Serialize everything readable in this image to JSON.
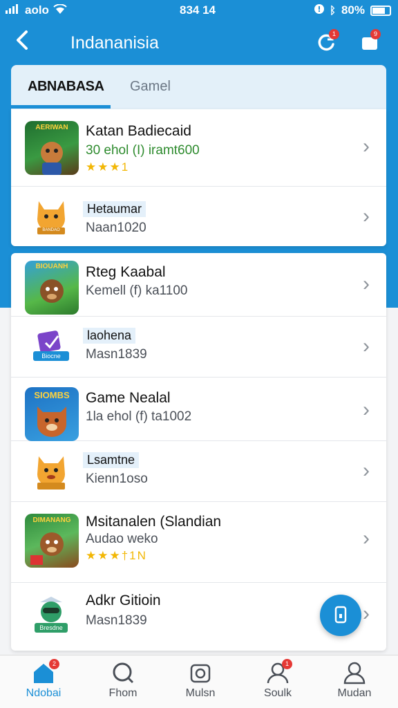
{
  "status": {
    "carrier": "aolo",
    "time": "834 14",
    "battery": "80%"
  },
  "header": {
    "title": "Indananisia",
    "refresh_badge": "1",
    "notify_badge": "9"
  },
  "tabs": [
    {
      "label": "ABNABASA"
    },
    {
      "label": "Gamel"
    }
  ],
  "card1": [
    {
      "title": "Katan Badiecaid",
      "sub": "30 ehol (I) iramt600",
      "stars": "★★★1",
      "thumb": "AERIWAN"
    },
    {
      "title": "Hetaumar",
      "sub": "Naan1020",
      "thumb": "BANDAO"
    }
  ],
  "card2": [
    {
      "title": "Rteg Kaabal",
      "sub": "Kemell (f) ka1100",
      "thumb": "BIOUANH"
    },
    {
      "title": "laohena",
      "sub": "Masn1839",
      "thumb": "Biocne"
    },
    {
      "title": "Game Nealal",
      "sub": "1la ehol (f) ta1002",
      "thumb": "SIOMBS"
    },
    {
      "title": "Lsamtne",
      "sub": "Kienn1oso",
      "thumb": ""
    },
    {
      "title": "Msitanalen (Slandian",
      "sub": "Audao weko",
      "stars": "★★★†1N",
      "thumb": "DIMANANG"
    },
    {
      "title": "Adkr Gitioin",
      "sub": "Masn1839",
      "thumb": "Bresdne"
    }
  ],
  "nav": [
    {
      "label": "Ndobai",
      "badge": "2"
    },
    {
      "label": "Fhom"
    },
    {
      "label": "Mulsn"
    },
    {
      "label": "Soulk",
      "badge": "1"
    },
    {
      "label": "Mudan"
    }
  ],
  "colors": {
    "primary": "#1b8fd6",
    "badge": "#e53935",
    "star": "#f2b705"
  }
}
